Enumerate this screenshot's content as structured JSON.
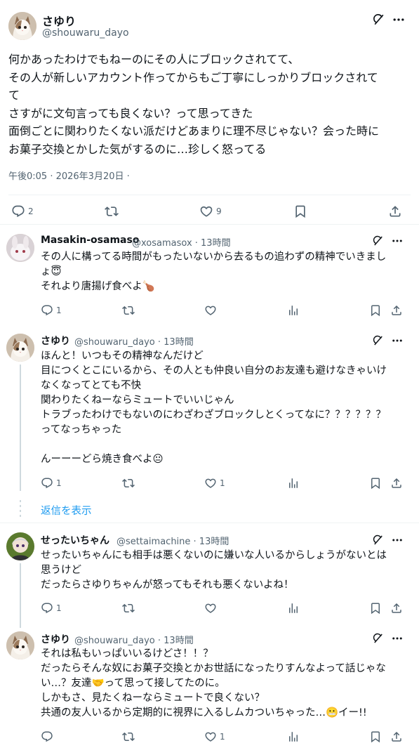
{
  "main_post": {
    "name": "さゆり",
    "handle": "@shouwaru_dayo",
    "text": "何かあったわけでもねーのにその人にブロックされてて、\nその人が新しいアカウント作ってからもご丁寧にしっかりブロックされて\nて\nさすがに文句言っても良くない？って思ってきた\n面倒ごとに関わりたくない派だけどあまりに理不尽じゃない？会った時に\nお菓子交換とかした気がするのに…珍しく怒ってる",
    "timestamp": "午後0:05 · 2026年3月20日 ·",
    "reply_count": "2",
    "like_count": "9"
  },
  "replies": [
    {
      "name": "Masakin-osamaso",
      "handle": "@xosamasox · 13時間",
      "text": "その人に構ってる時間がもったいないから去るもの追わずの精神でいきまし\nょ😇\nそれより唐揚げ食べよ🍗",
      "reply_count": "1",
      "like_count": ""
    },
    {
      "name": "さゆり",
      "handle": "@shouwaru_dayo · 13時間",
      "text": "ほんと！いつもその精神なんだけど\n目につくとこにいるから、その人とも仲良い自分のお友達も避けなきゃいけ\nなくなってとても不快\n関わりたくねーならミュートでいいじゃん\nトラブったわけでもないのにわざわざブロックしとくってなに？？？？？？\nってなっちゃった\n\nんーーーどら焼き食べよ😐",
      "reply_count": "1",
      "like_count": "1"
    },
    {
      "name": "せったいちゃん",
      "handle": "@settaimachine · 13時間",
      "text": "せったいちゃんにも相手は悪くないのに嫌いな人いるからしょうがないとは\n思うけど\nだったらさゆりちゃんが怒ってもそれも悪くないよね！",
      "reply_count": "1",
      "like_count": ""
    },
    {
      "name": "さゆり",
      "handle": "@shouwaru_dayo · 13時間",
      "text": "それは私もいっぱいいるけどさ！！？\nだったらそんな奴にお菓子交換とかお世話になったりすんなよって話じゃな\nい…？友達🤝って思って接してたのに。\nしかもさ、見たくねーならミュートで良くない？\n共通の友人いるから定期的に視界に入るしムカついちゃった…😬イー!!",
      "reply_count": "",
      "like_count": "1"
    }
  ],
  "show_replies_label": "返信を表示",
  "icons": [
    "grok-icon",
    "more-icon",
    "reply-icon",
    "retweet-icon",
    "like-icon",
    "bookmark-icon",
    "share-icon",
    "views-icon"
  ],
  "colors": {
    "link": "#1d9bf0",
    "muted": "#536471",
    "text": "#0f1419"
  }
}
